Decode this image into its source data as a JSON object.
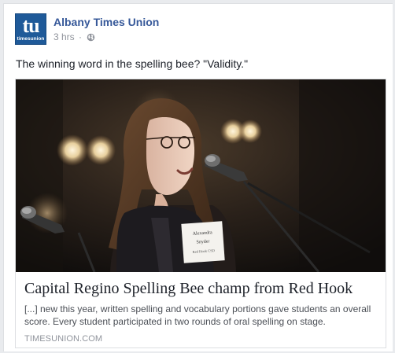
{
  "post": {
    "page_name": "Albany Times Union",
    "time": "3 hrs",
    "separator": "·",
    "privacy_icon": "globe-icon",
    "text": "The winning word in the spelling bee? \"Validity.\""
  },
  "logo": {
    "main": "tu",
    "sub": "timesunion",
    "color": "#1f5a99"
  },
  "link_preview": {
    "image_alt": "Student speaking at a microphone on stage",
    "name_card_lines": [
      "Alexandra",
      "Snyder",
      "Red Hook CSD"
    ],
    "title": "Capital Regino Spelling Bee champ from Red Hook",
    "description": "[...] new this year, written spelling and vocabulary portions gave students an overall score. Every student participated in two rounds of oral spelling on stage.",
    "source": "TIMESUNION.COM"
  },
  "colors": {
    "page_name": "#365899",
    "meta": "#90949c",
    "background": "#e9ebee"
  }
}
